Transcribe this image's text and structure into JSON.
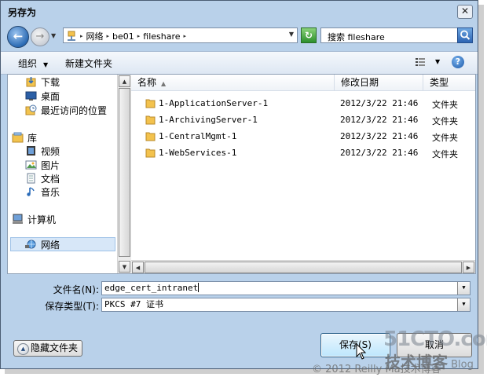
{
  "window": {
    "title": "另存为"
  },
  "address": {
    "breadcrumbs": [
      "网络",
      "be01",
      "fileshare"
    ],
    "search_placeholder": "搜索 fileshare"
  },
  "toolbar": {
    "organize": "组织",
    "new_folder": "新建文件夹"
  },
  "nav": {
    "items": [
      {
        "label": "下载",
        "icon": "download-folder-icon"
      },
      {
        "label": "桌面",
        "icon": "desktop-icon"
      },
      {
        "label": "最近访问的位置",
        "icon": "recent-places-icon"
      },
      {
        "label": "库",
        "icon": "library-icon"
      },
      {
        "label": "视频",
        "icon": "video-icon"
      },
      {
        "label": "图片",
        "icon": "pictures-icon"
      },
      {
        "label": "文档",
        "icon": "documents-icon"
      },
      {
        "label": "音乐",
        "icon": "music-icon"
      },
      {
        "label": "计算机",
        "icon": "computer-icon"
      },
      {
        "label": "网络",
        "icon": "network-icon",
        "selected": true
      }
    ]
  },
  "files": {
    "columns": [
      "名称",
      "修改日期",
      "类型"
    ],
    "rows": [
      {
        "name": "1-ApplicationServer-1",
        "date": "2012/3/22 21:46",
        "type": "文件夹"
      },
      {
        "name": "1-ArchivingServer-1",
        "date": "2012/3/22 21:46",
        "type": "文件夹"
      },
      {
        "name": "1-CentralMgmt-1",
        "date": "2012/3/22 21:46",
        "type": "文件夹"
      },
      {
        "name": "1-WebServices-1",
        "date": "2012/3/22 21:46",
        "type": "文件夹"
      }
    ]
  },
  "form": {
    "filename_label": "文件名(N):",
    "filename_value": "edge_cert_intranet",
    "filetype_label": "保存类型(T):",
    "filetype_value": "PKCS #7 证书"
  },
  "buttons": {
    "hide_folders": "隐藏文件夹",
    "save": "保存(S)",
    "cancel": "取消"
  },
  "watermark": {
    "site": "51CTO.com",
    "blog_prefix": "技术博客",
    "blog_suffix": "Blog",
    "copyright": "© 2012 Reilly Ma技术博客"
  }
}
